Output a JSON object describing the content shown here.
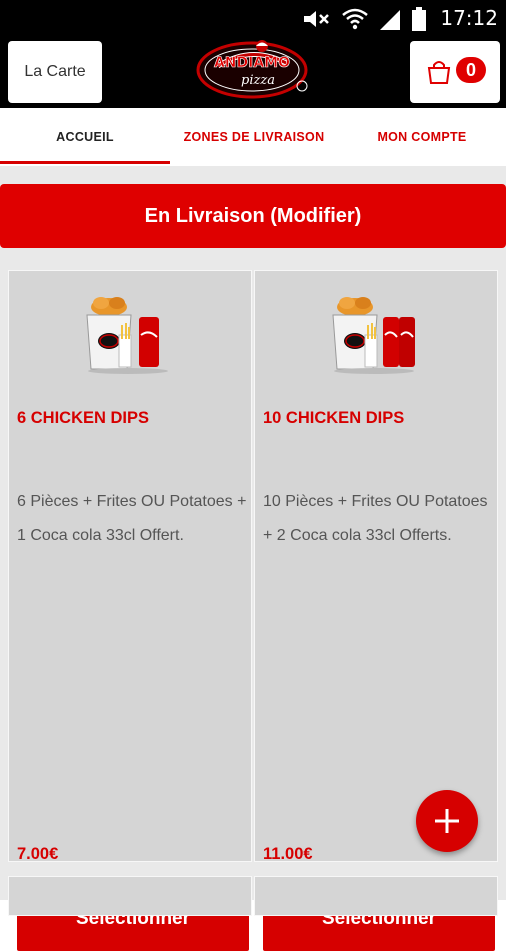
{
  "status_bar": {
    "time": "17:12",
    "icons": [
      "mute-icon",
      "wifi-icon",
      "signal-icon",
      "battery-icon"
    ]
  },
  "app_bar": {
    "menu_button_label": "La Carte",
    "logo_text": "ANDIAMO pizza",
    "cart_count": "0"
  },
  "tabs": [
    {
      "label": "ACCUEIL",
      "active": true
    },
    {
      "label": "ZONES DE LIVRAISON",
      "active": false
    },
    {
      "label": "MON COMPTE",
      "active": false
    }
  ],
  "delivery_mode_label": "En Livraison (Modifier)",
  "products": [
    {
      "title": "6 CHICKEN DIPS",
      "description": "6 Pièces + Frites OU Potatoes + 1 Coca cola 33cl Offert.",
      "price": "7.00€",
      "button_label": "Sélectionner"
    },
    {
      "title": "10 CHICKEN DIPS",
      "description": "10 Pièces + Frites OU Potatoes + 2 Coca cola 33cl Offerts.",
      "price": "11.00€",
      "button_label": "Sélectionner"
    }
  ],
  "colors": {
    "accent": "#d60000",
    "card_bg": "#d5d5d5",
    "page_bg": "#e9e9e9",
    "app_bar_bg": "#000000"
  },
  "fab_icon": "plus-icon"
}
